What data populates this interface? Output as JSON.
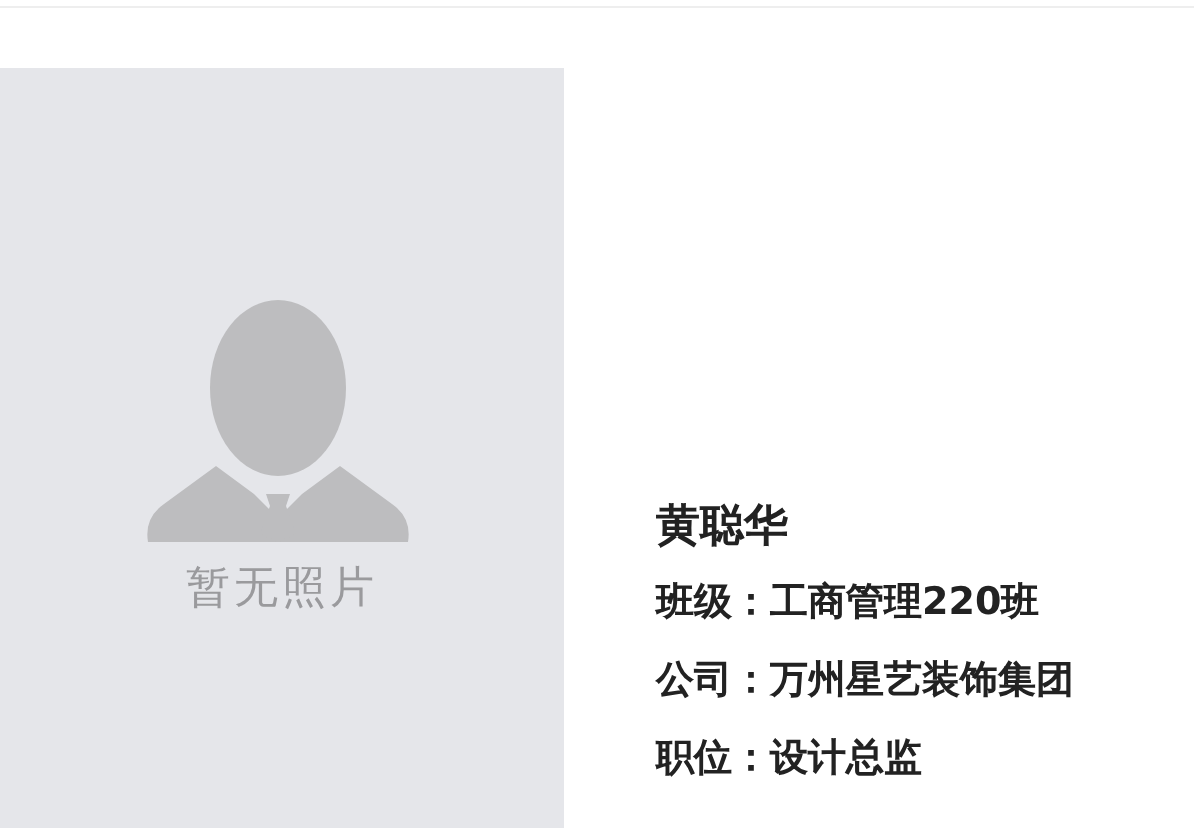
{
  "photo": {
    "caption": "暂无照片"
  },
  "profile": {
    "name": "黄聪华",
    "fields": [
      {
        "label": "班级：",
        "value": "工商管理220班"
      },
      {
        "label": "公司：",
        "value": "万州星艺装饰集团"
      },
      {
        "label": "职位：",
        "value": "设计总监"
      }
    ]
  }
}
